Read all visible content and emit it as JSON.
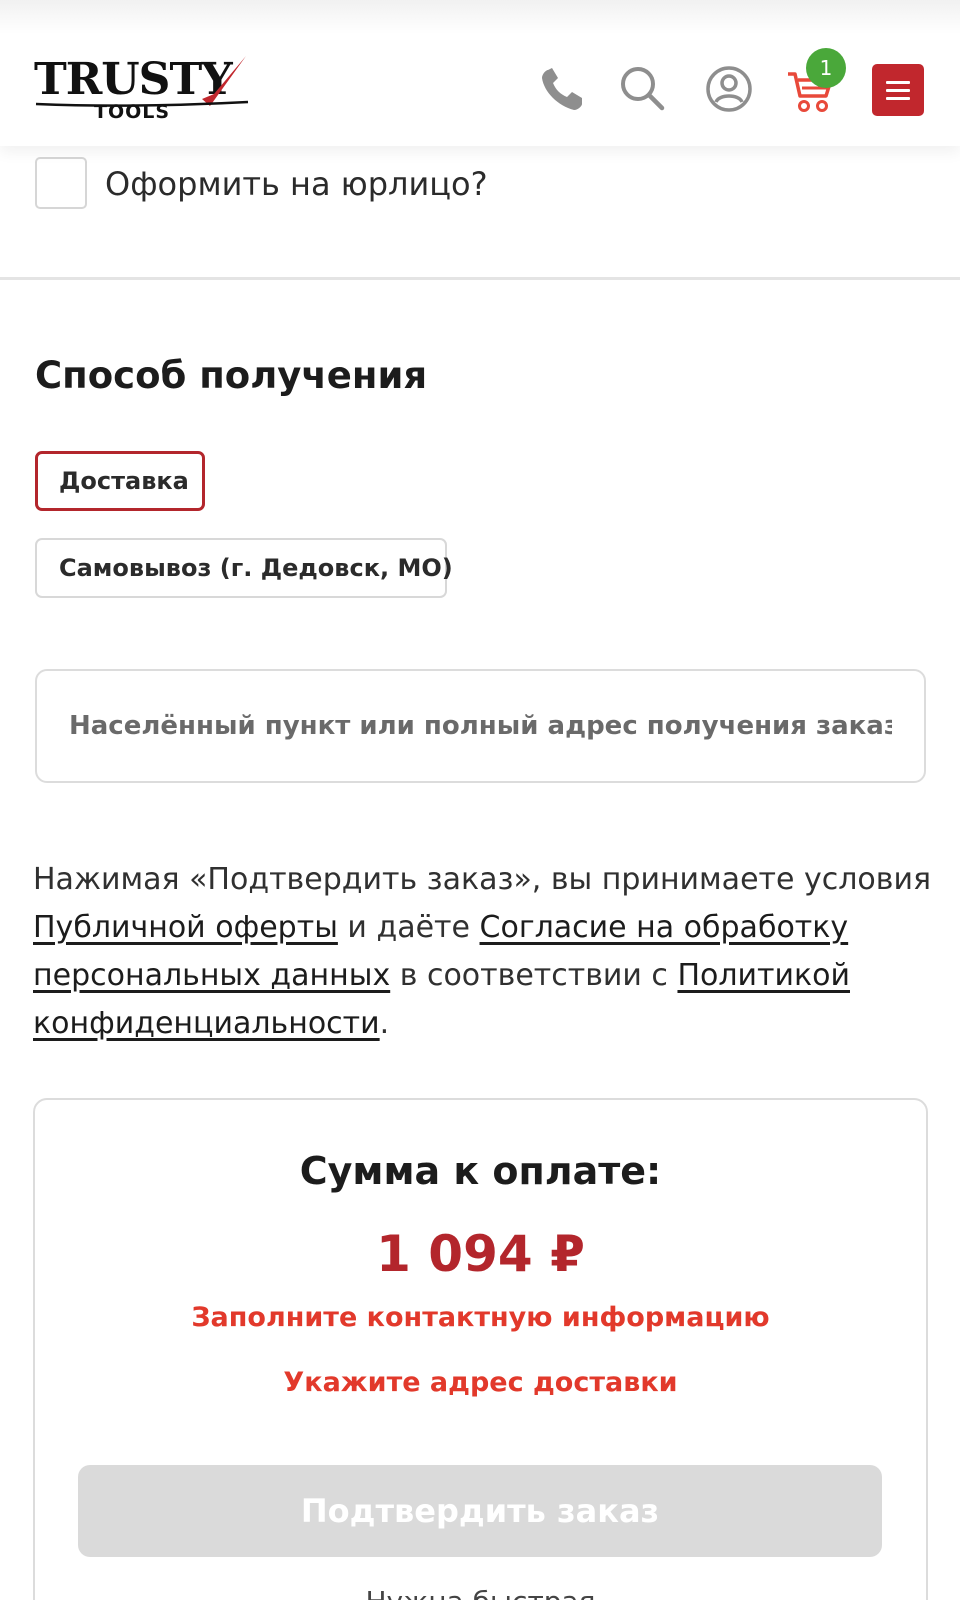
{
  "header": {
    "logo_main": "TRUSTY",
    "logo_sub": "TOOLS",
    "cart_count": "1",
    "icons": [
      "phone-icon",
      "search-icon",
      "user-icon",
      "cart-icon",
      "menu-icon"
    ],
    "accent_color": "#c1272d"
  },
  "legal_entity": {
    "label": "Оформить на юрлицо?",
    "checked": false
  },
  "delivery": {
    "title": "Способ получения",
    "options": [
      {
        "label": "Доставка",
        "selected": true
      },
      {
        "label": "Самовывоз (г. Дедовск, МО)",
        "selected": false
      }
    ],
    "address_placeholder": "Населённый пункт или полный адрес получения заказа",
    "address_value": ""
  },
  "consent": {
    "text_1": "Нажимая «Подтвердить заказ», вы принимаете условия ",
    "link_offer": "Публичной оферты",
    "text_2": " и даёте ",
    "link_agreement": "Согласие на обработку персональных данных",
    "text_3": " в соответствии с ",
    "link_policy": "Политикой конфиденциальности",
    "text_4": "."
  },
  "summary": {
    "title": "Сумма к оплате:",
    "amount": "1 094 ₽",
    "warnings": [
      "Заполните контактную информацию",
      "Укажите адрес доставки"
    ],
    "confirm_label": "Подтвердить заказ",
    "confirm_disabled": true,
    "cut_text": "Нужна быстрая"
  }
}
